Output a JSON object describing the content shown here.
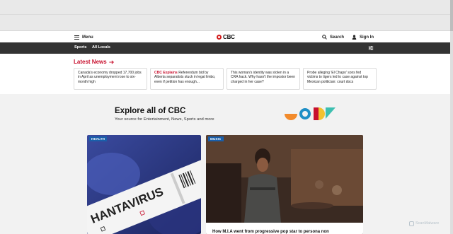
{
  "header": {
    "menu_label": "Menu",
    "logo_text": "CBC",
    "search_label": "Search",
    "signin_label": "Sign In"
  },
  "subnav": {
    "items": [
      "Sports",
      "All Locals"
    ]
  },
  "latest": {
    "title": "Latest News",
    "cards": [
      {
        "tag": "",
        "text": "Canada's economy dropped 17,700 jobs in April as unemployment rose to six-month high"
      },
      {
        "tag": "CBC Explains",
        "text": "Referendum bid by Alberta separatists stuck in legal limbo, even if petition has enough..."
      },
      {
        "tag": "",
        "text": "This woman's identity was stolen in a CRA hack. Why hasn't the impostor been charged in her case?"
      },
      {
        "tag": "",
        "text": "Probe alleging 'El Chapo' sons fed victims to tigers led to case against top Mexican politician: court docs"
      }
    ]
  },
  "explore": {
    "title": "Explore all of CBC",
    "subtitle": "Your source for Entertainment, News, Sports and more"
  },
  "stories": [
    {
      "badge": "HEALTH",
      "image_text": "HANTAVIRUS",
      "headline": ""
    },
    {
      "badge": "MUSIC",
      "headline": "How M.I.A went from progressive pop star to persona non"
    }
  ],
  "watermark": "ScanMalware",
  "colors": {
    "brand_red": "#c8102e",
    "subnav_bg": "#333333",
    "badge_blue": "#1a5faa"
  }
}
